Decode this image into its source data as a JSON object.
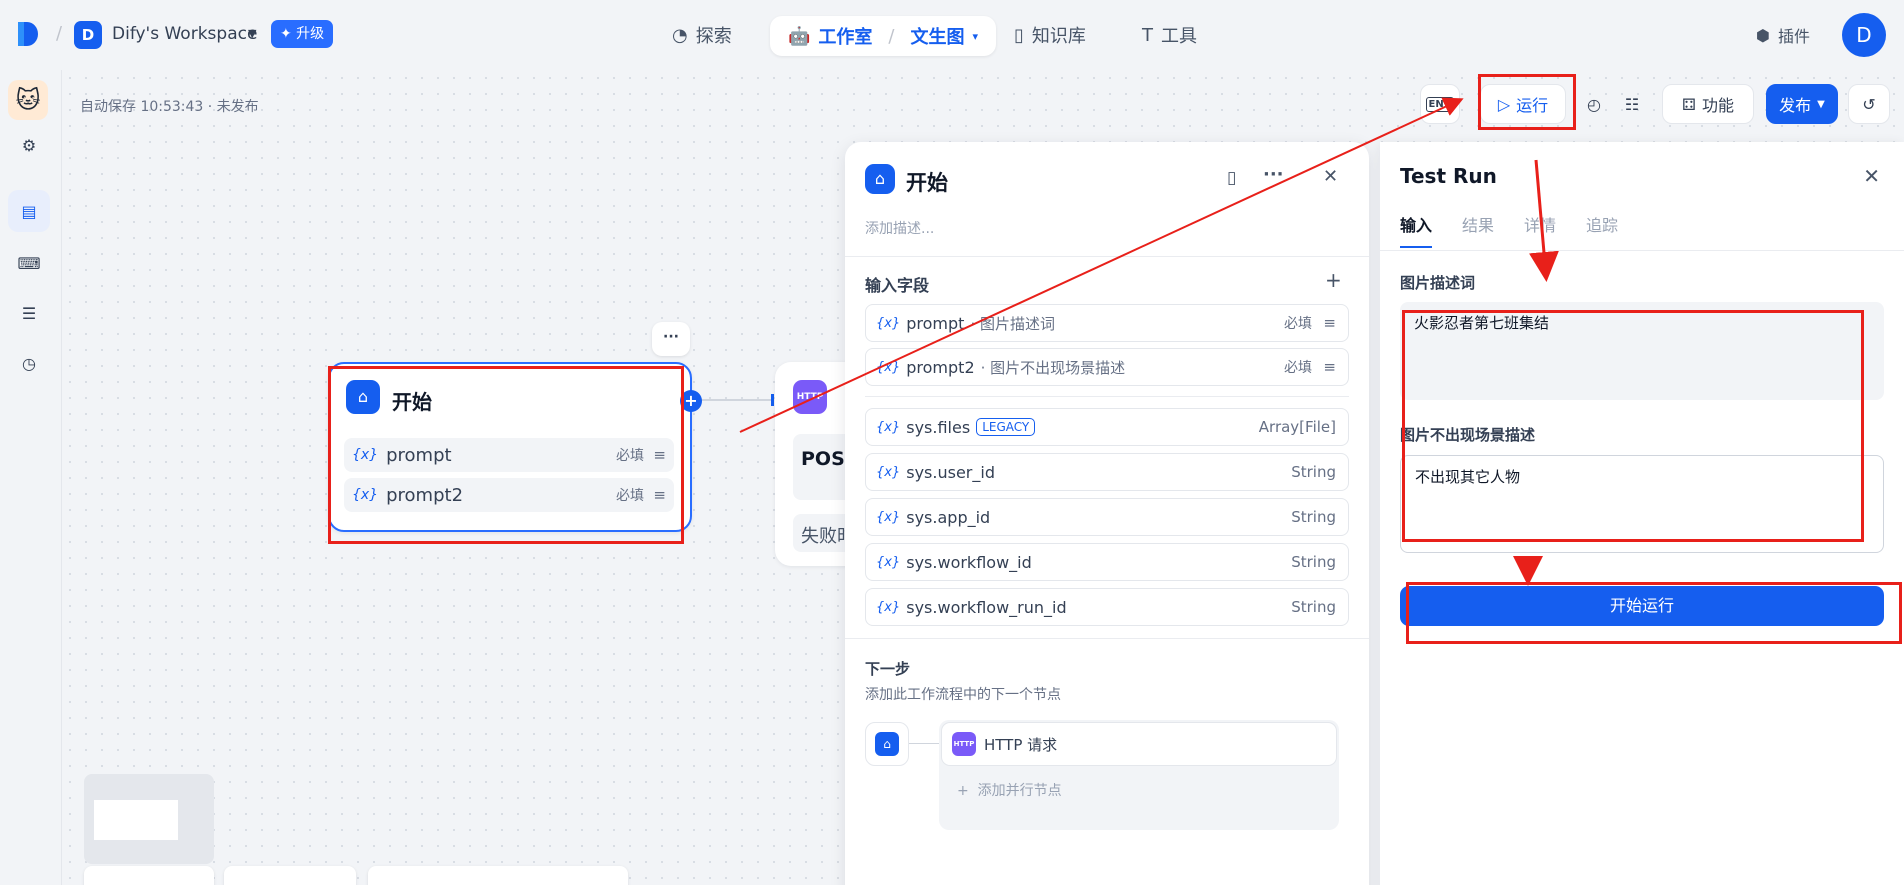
{
  "topbar": {
    "workspace_initial": "D",
    "workspace_name": "Dify's Workspace",
    "upgrade_label": "✦ 升级",
    "nav": {
      "explore": "探索",
      "studio": "工作室",
      "app_name": "文生图",
      "knowledge": "知识库",
      "tools": "工具",
      "plugins": "插件"
    },
    "user_initial": "D"
  },
  "canvas": {
    "autosave": "自动保存 10:53:43 · 未发布",
    "start_node": {
      "title": "开始",
      "vars": [
        {
          "name": "prompt",
          "required": "必填"
        },
        {
          "name": "prompt2",
          "required": "必填"
        }
      ]
    },
    "http_node": {
      "badge": "HTTP",
      "method": "POS",
      "fail_label": "失败时"
    }
  },
  "toolbar": {
    "env": "ENV",
    "run": "运行",
    "features": "功能",
    "publish": "发布"
  },
  "node_panel": {
    "title": "开始",
    "description_placeholder": "添加描述...",
    "input_fields_label": "输入字段",
    "user_fields": [
      {
        "name": "prompt",
        "desc": "· 图片描述词",
        "required": "必填"
      },
      {
        "name": "prompt2",
        "desc": "· 图片不出现场景描述",
        "required": "必填"
      }
    ],
    "sys_fields": [
      {
        "name": "sys.files",
        "badge": "LEGACY",
        "type": "Array[File]"
      },
      {
        "name": "sys.user_id",
        "type": "String"
      },
      {
        "name": "sys.app_id",
        "type": "String"
      },
      {
        "name": "sys.workflow_id",
        "type": "String"
      },
      {
        "name": "sys.workflow_run_id",
        "type": "String"
      }
    ],
    "next_step_label": "下一步",
    "next_step_desc": "添加此工作流程中的下一个节点",
    "next_node": "HTTP 请求",
    "add_parallel": "添加并行节点"
  },
  "test_run": {
    "title": "Test Run",
    "tabs": [
      "输入",
      "结果",
      "详情",
      "追踪"
    ],
    "field1_label": "图片描述词",
    "field1_value": "火影忍者第七班集结",
    "field2_label": "图片不出现场景描述",
    "field2_value": "不出现其它人物",
    "run_button": "开始运行"
  },
  "annotation_color": "#e8201a"
}
